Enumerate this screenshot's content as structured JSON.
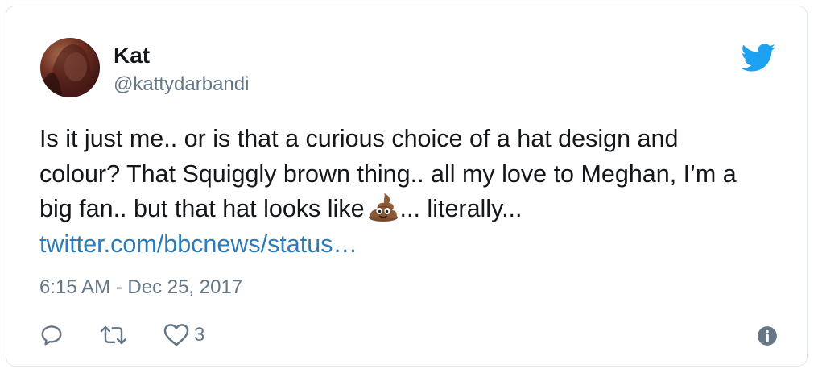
{
  "user": {
    "display_name": "Kat",
    "handle": "@kattydarbandi"
  },
  "tweet": {
    "text_lines": [
      "Is it just me.. or is that a curious choice of a hat design and",
      "colour? That Squiggly brown thing.. all my love to Meghan, I’m a",
      "big fan.. but that hat looks like"
    ],
    "text_after_emoji": "... literally...",
    "emoji": "pile-of-poo",
    "link": "twitter.com/bbcnews/status…",
    "timestamp": "6:15 AM - Dec 25, 2017"
  },
  "actions": {
    "like_count": "3"
  },
  "icons": {
    "brand": "twitter-bird-icon",
    "reply": "reply-icon",
    "retweet": "retweet-icon",
    "like": "heart-icon",
    "info": "info-icon"
  },
  "colors": {
    "text": "#14171a",
    "secondary": "#657786",
    "link": "#2b7bb9",
    "twitter_blue": "#1da1f2",
    "border": "#e1e8ed"
  }
}
